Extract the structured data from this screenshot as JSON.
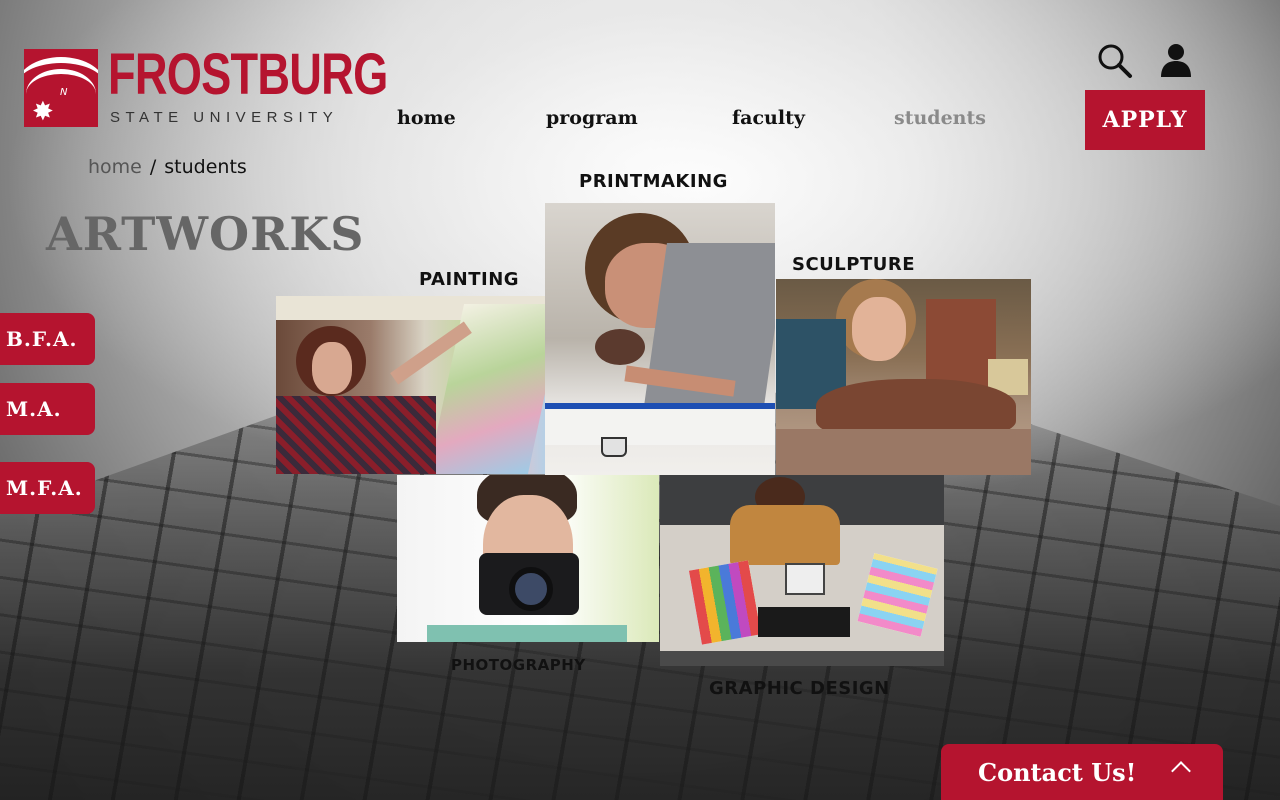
{
  "logo": {
    "name": "FROSTBURG",
    "subtitle": "STATE UNIVERSITY"
  },
  "nav": {
    "items": [
      {
        "label": "home"
      },
      {
        "label": "program"
      },
      {
        "label": "faculty"
      },
      {
        "label": "students"
      }
    ],
    "active": "students"
  },
  "header": {
    "search_icon": "search-icon",
    "user_icon": "user-icon",
    "apply_label": "APPLY"
  },
  "breadcrumb": {
    "home": "home",
    "separator": "/",
    "current": "students"
  },
  "page_title": "ARTWORKS",
  "degrees": [
    {
      "label": "B.F.A."
    },
    {
      "label": "M.A."
    },
    {
      "label": "M.F.A."
    }
  ],
  "gallery": {
    "painting": "PAINTING",
    "printmaking": "PRINTMAKING",
    "sculpture": "SCULPTURE",
    "photography": "PHOTOGRAPHY",
    "graphic_design": "GRAPHIC DESIGN"
  },
  "contact": {
    "label": "Contact Us!"
  },
  "colors": {
    "brand_red": "#b5142f",
    "active_nav": "#8a8a8a",
    "title_gray": "#666666"
  }
}
